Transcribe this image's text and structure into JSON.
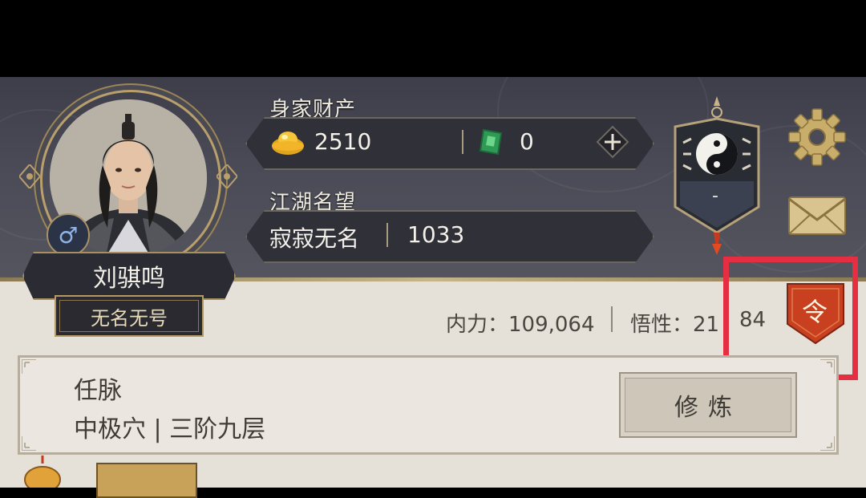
{
  "player": {
    "name": "刘骐鸣",
    "title": "无名无号",
    "gender_icon": "♂"
  },
  "wealth": {
    "label": "身家财产",
    "gold_amount": "2510",
    "jade_amount": "0"
  },
  "reputation": {
    "label": "江湖名望",
    "rank_text": "寂寂无名",
    "value": "1033"
  },
  "sect_badge": {
    "value": "-"
  },
  "stats": {
    "inner_power": "内力：109,064",
    "comprehension": "悟性：21",
    "comprehension_tail": "84"
  },
  "order_button": {
    "glyph": "令"
  },
  "meridian": {
    "name": "任脉",
    "detail": "中极穴 | 三阶九层",
    "train_label": "修炼"
  },
  "icons": {
    "gold": "gold-ingot-icon",
    "jade": "jade-token-icon",
    "add": "plus-icon",
    "settings": "gear-icon",
    "mail": "mail-icon",
    "sect": "yin-yang-icon",
    "order": "order-token-icon"
  },
  "colors": {
    "header_bg": "#4b4b57",
    "panel_bg": "#e5e1d9",
    "accent_gold": "#b99f6c",
    "highlight_red": "#e52e42",
    "order_red": "#c8401f"
  }
}
